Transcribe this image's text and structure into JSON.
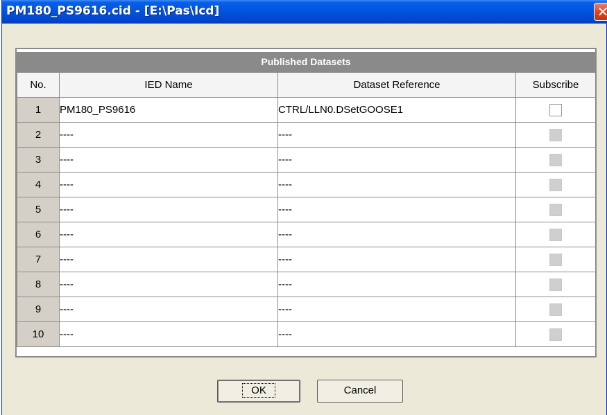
{
  "window": {
    "title": "PM180_PS9616.cid - [E:\\Pas\\Icd]",
    "close_symbol": "✕"
  },
  "grid": {
    "caption": "Published Datasets",
    "columns": [
      "No.",
      "IED Name",
      "Dataset Reference",
      "Subscribe"
    ],
    "rows": [
      {
        "no": "1",
        "ied": "PM180_PS9616",
        "ref": "CTRL/LLN0.DSetGOOSE1",
        "subscribe_enabled": true,
        "subscribed": false
      },
      {
        "no": "2",
        "ied": "----",
        "ref": "----",
        "subscribe_enabled": false,
        "subscribed": false
      },
      {
        "no": "3",
        "ied": "----",
        "ref": "----",
        "subscribe_enabled": false,
        "subscribed": false
      },
      {
        "no": "4",
        "ied": "----",
        "ref": "----",
        "subscribe_enabled": false,
        "subscribed": false
      },
      {
        "no": "5",
        "ied": "----",
        "ref": "----",
        "subscribe_enabled": false,
        "subscribed": false
      },
      {
        "no": "6",
        "ied": "----",
        "ref": "----",
        "subscribe_enabled": false,
        "subscribed": false
      },
      {
        "no": "7",
        "ied": "----",
        "ref": "----",
        "subscribe_enabled": false,
        "subscribed": false
      },
      {
        "no": "8",
        "ied": "----",
        "ref": "----",
        "subscribe_enabled": false,
        "subscribed": false
      },
      {
        "no": "9",
        "ied": "----",
        "ref": "----",
        "subscribe_enabled": false,
        "subscribed": false
      },
      {
        "no": "10",
        "ied": "----",
        "ref": "----",
        "subscribe_enabled": false,
        "subscribed": false
      }
    ]
  },
  "buttons": {
    "ok": "OK",
    "cancel": "Cancel"
  },
  "colors": {
    "titlebar": "#0054e3",
    "dialog_bg": "#ece9d8",
    "grid_header": "#8a8a8a",
    "close": "#d8441e"
  }
}
